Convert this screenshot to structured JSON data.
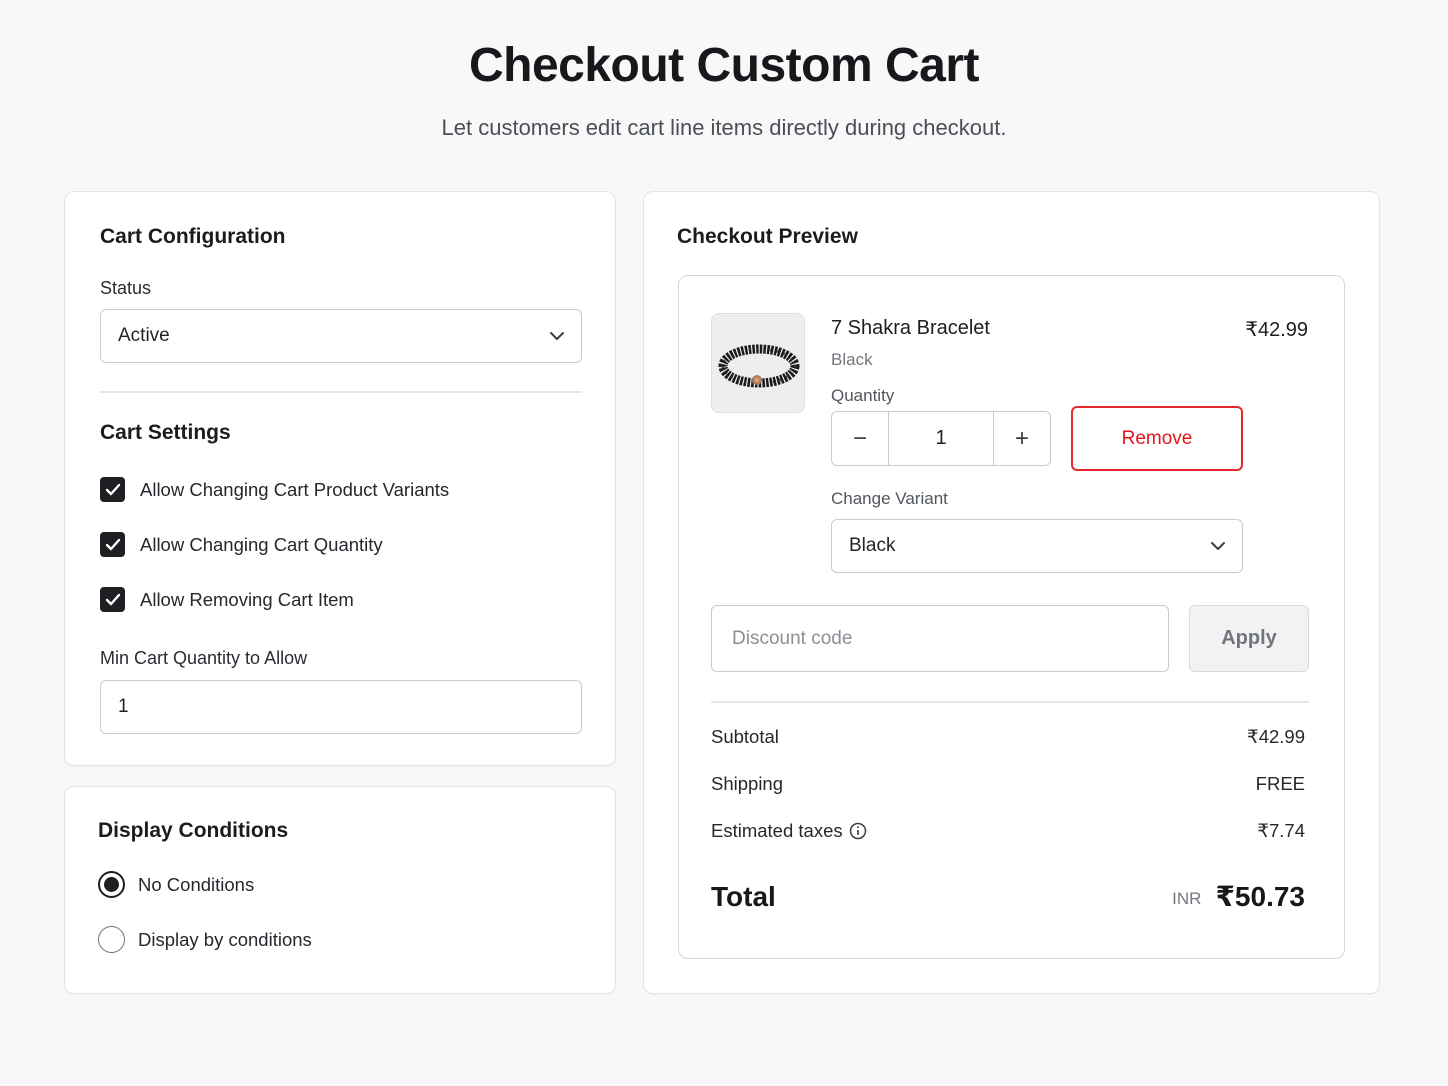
{
  "header": {
    "title": "Checkout Custom Cart",
    "subtitle": "Let customers edit cart line items directly during checkout."
  },
  "config": {
    "title": "Cart Configuration",
    "status_label": "Status",
    "status_value": "Active",
    "settings_title": "Cart Settings",
    "settings": [
      {
        "label": "Allow Changing Cart Product Variants",
        "checked": true
      },
      {
        "label": "Allow Changing Cart Quantity",
        "checked": true
      },
      {
        "label": "Allow Removing Cart Item",
        "checked": true
      }
    ],
    "min_qty_label": "Min Cart Quantity to Allow",
    "min_qty_value": "1"
  },
  "display": {
    "title": "Display Conditions",
    "options": [
      {
        "label": "No Conditions",
        "selected": true
      },
      {
        "label": "Display by conditions",
        "selected": false
      }
    ]
  },
  "preview": {
    "title": "Checkout Preview",
    "product": {
      "name": "7 Shakra Bracelet",
      "price": "₹42.99",
      "variant": "Black",
      "image": "bracelet-image"
    },
    "quantity_label": "Quantity",
    "quantity": "1",
    "minus": "−",
    "plus": "+",
    "remove_label": "Remove",
    "variant_label": "Change Variant",
    "variant_value": "Black",
    "discount_placeholder": "Discount code",
    "apply_label": "Apply",
    "summary": {
      "subtotal_label": "Subtotal",
      "subtotal_value": "₹42.99",
      "shipping_label": "Shipping",
      "shipping_value": "FREE",
      "taxes_label": "Estimated taxes",
      "taxes_value": "₹7.74",
      "total_label": "Total",
      "currency": "INR",
      "total_value": "₹50.73"
    }
  },
  "colors": {
    "accent_dark": "#1d1f23",
    "remove_red": "#e5282d",
    "background": "#f8f8f9"
  }
}
